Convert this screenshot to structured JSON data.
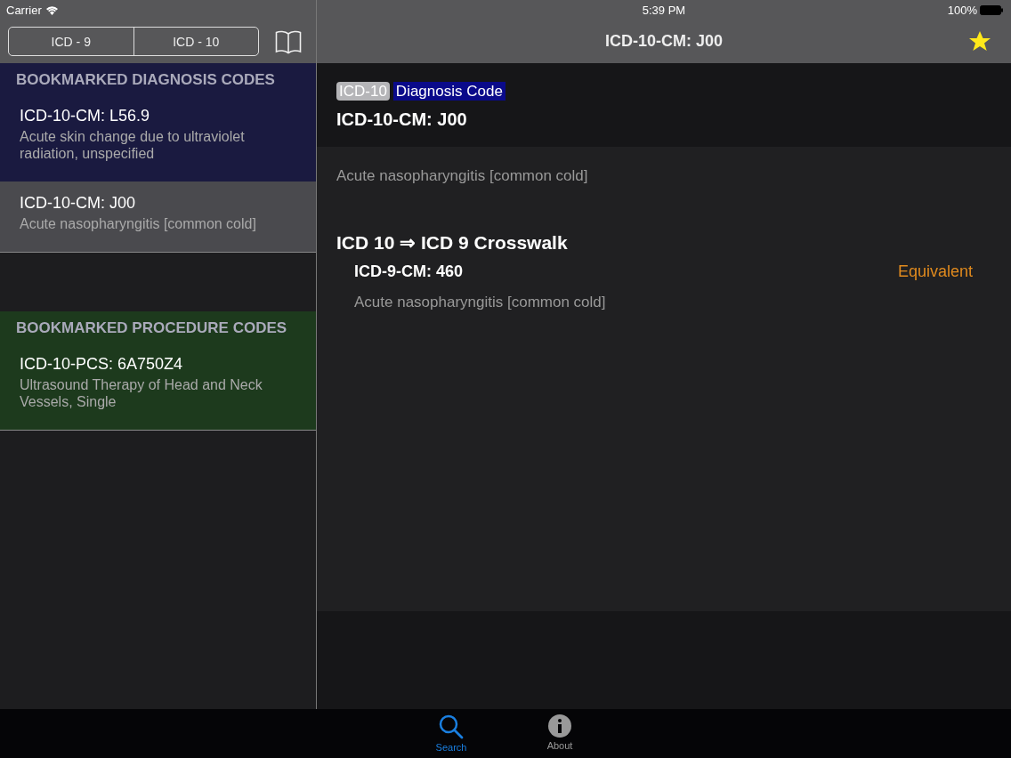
{
  "status_bar": {
    "carrier": "Carrier",
    "time": "5:39 PM",
    "battery": "100%"
  },
  "segments": [
    {
      "label": "ICD - 9",
      "selected": false
    },
    {
      "label": "ICD - 10",
      "selected": false
    }
  ],
  "nav": {
    "title": "ICD-10-CM: J00",
    "bookmarked": true
  },
  "sections": [
    {
      "title": "BOOKMARKED DIAGNOSIS CODES",
      "color": "#1a1a40",
      "rows": [
        {
          "code": "ICD-10-CM: L56.9",
          "description": "Acute skin change due to ultraviolet radiation, unspecified",
          "selected": false
        },
        {
          "code": "ICD-10-CM: J00",
          "description": "Acute nasopharyngitis [common cold]",
          "selected": true
        }
      ]
    },
    {
      "title": "BOOKMARKED PROCEDURE CODES",
      "color": "#1d3a1d",
      "rows": [
        {
          "code": "ICD-10-PCS: 6A750Z4",
          "description": "Ultrasound Therapy of Head and Neck Vessels, Single",
          "selected": false
        }
      ]
    }
  ],
  "detail": {
    "tags": [
      {
        "label": "ICD-10",
        "kind": "version"
      },
      {
        "label": "Diagnosis Code",
        "kind": "type"
      }
    ],
    "code": "ICD-10-CM: J00",
    "description": "Acute nasopharyngitis [common cold]",
    "crosswalk_title": "ICD 10 ⇒ ICD 9 Crosswalk",
    "mappings": [
      {
        "code": "ICD-9-CM: 460",
        "match": "Equivalent",
        "description": "Acute nasopharyngitis [common cold]"
      }
    ]
  },
  "tab_bar": [
    {
      "label": "Search",
      "kind": "search",
      "selected": true
    },
    {
      "label": "About",
      "kind": "info",
      "selected": false
    }
  ]
}
